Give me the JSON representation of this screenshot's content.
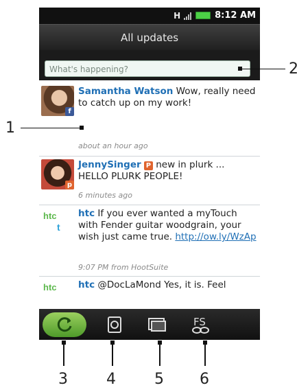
{
  "status_bar": {
    "data_icon": "H",
    "time": "8:12 AM"
  },
  "title_bar": {
    "title": "All updates"
  },
  "compose": {
    "placeholder": "What's happening?"
  },
  "feed": [
    {
      "author": "Samantha Watson",
      "text": " Wow, really need to catch up on my work!",
      "meta": "about an hour ago",
      "source_icon": "facebook-icon"
    },
    {
      "author": "JennySinger",
      "badge": "P",
      "text": " new in plurk ... HELLO PLURK PEOPLE!",
      "meta": "6 minutes ago",
      "source_icon": "plurk-icon"
    },
    {
      "author": "htc",
      "text": " If you ever wanted a myTouch with Fender guitar woodgrain, your wish just came true. ",
      "link": "http://ow.ly/WzAp",
      "meta": "9:07 PM from HootSuite",
      "source_icon": "twitter-icon",
      "logo": "htc",
      "logo_badge": "t"
    },
    {
      "author": "htc",
      "text": " @DocLaMond Yes, it is. Feel",
      "logo": "htc"
    }
  ],
  "bottom_bar": {
    "buttons": [
      {
        "name": "refresh",
        "icon": "refresh-icon"
      },
      {
        "name": "accounts",
        "icon": "accounts-icon"
      },
      {
        "name": "photos",
        "icon": "photos-icon"
      },
      {
        "name": "friend-stream",
        "icon": "link-icon",
        "label": "FS"
      }
    ]
  },
  "callouts": [
    "1",
    "2",
    "3",
    "4",
    "5",
    "6"
  ],
  "colors": {
    "author_blue": "#1f6fb5",
    "refresh_green": "#6cbf3f",
    "htc_green": "#5cb84c"
  }
}
